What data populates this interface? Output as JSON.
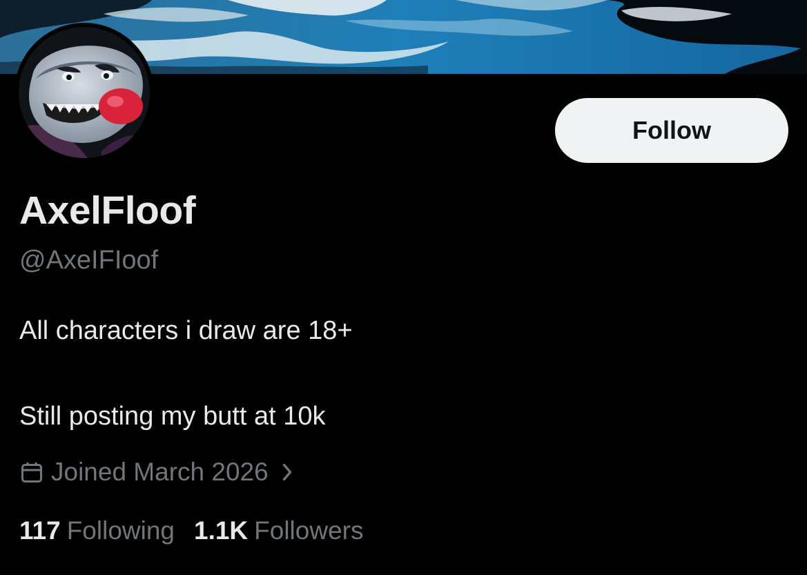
{
  "profile": {
    "display_name": "AxelFloof",
    "handle": "@AxeIFIoof",
    "bio_line_1": "All characters i draw are 18+",
    "bio_line_2": "Still posting my butt at 10k",
    "joined": "Joined March 2026",
    "following_count": "117",
    "following_label": "Following",
    "followers_count": "1.1K",
    "followers_label": "Followers"
  },
  "actions": {
    "follow_label": "Follow"
  },
  "icons": {
    "calendar": "calendar-icon",
    "chevron": "chevron-right-icon"
  },
  "colors": {
    "background": "#000000",
    "primary_text": "#e7e9ea",
    "secondary_text": "#71767b",
    "follow_button_bg": "#eff3f4",
    "follow_button_text": "#0f1419"
  }
}
